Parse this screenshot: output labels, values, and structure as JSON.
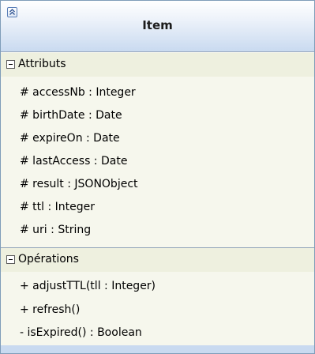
{
  "class_name": "Item",
  "attributes_section": {
    "label": "Attributs",
    "items": [
      "# accessNb : Integer",
      "# birthDate : Date",
      "# expireOn : Date",
      "# lastAccess : Date",
      "# result : JSONObject",
      "# ttl : Integer",
      "# uri : String"
    ]
  },
  "operations_section": {
    "label": "Opérations",
    "items": [
      "+ adjustTTL(tll : Integer)",
      "+ refresh()",
      "- isExpired() : Boolean"
    ]
  }
}
